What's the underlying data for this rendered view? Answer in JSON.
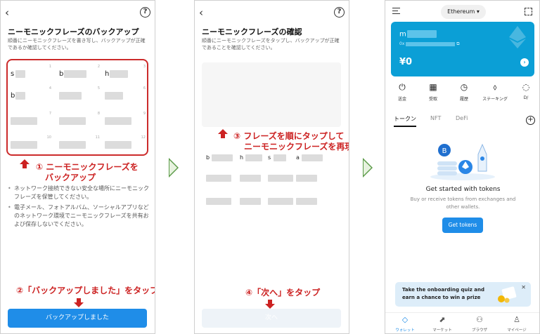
{
  "panel1": {
    "title": "ニーモニックフレーズのバックアップ",
    "subtitle": "順番にニーモニックフレーズを書き写し、バックアップが正確であるか確認してください。",
    "words": [
      {
        "n": "1",
        "prefix": "s"
      },
      {
        "n": "2",
        "prefix": "b"
      },
      {
        "n": "3",
        "prefix": "h"
      },
      {
        "n": "4",
        "prefix": "b"
      },
      {
        "n": "5",
        "prefix": ""
      },
      {
        "n": "6",
        "prefix": ""
      },
      {
        "n": "7",
        "prefix": ""
      },
      {
        "n": "8",
        "prefix": ""
      },
      {
        "n": "9",
        "prefix": ""
      },
      {
        "n": "10",
        "prefix": ""
      },
      {
        "n": "11",
        "prefix": ""
      },
      {
        "n": "12",
        "prefix": ""
      }
    ],
    "annotation_1a": "① ニーモニックフレーズを",
    "annotation_1b": "バックアップ",
    "bullet_1": "ネットワーク接続できない安全な場所にニーモニックフレーズを保管してください。",
    "bullet_2": "電子メール、フォトアルバム、ソーシャルアプリなどのネットワーク環境でニーモニックフレーズを共有および保存しないでください。",
    "annotation_2": "②「バックアップしました」をタップ",
    "button_label": "バックアップしました"
  },
  "panel2": {
    "title": "ニーモニックフレーズの確認",
    "subtitle": "順番にニーモニックフレーズをタップし、バックアップが正確であることを確認してください。",
    "annotation_3a": "③ フレーズを順にタップして",
    "annotation_3b": "ニーモニックフレーズを再現",
    "chips": [
      {
        "prefix": "b"
      },
      {
        "prefix": "h"
      },
      {
        "prefix": "s"
      },
      {
        "prefix": "a"
      },
      {
        "prefix": ""
      },
      {
        "prefix": ""
      },
      {
        "prefix": ""
      },
      {
        "prefix": ""
      },
      {
        "prefix": ""
      },
      {
        "prefix": ""
      },
      {
        "prefix": ""
      },
      {
        "prefix": ""
      }
    ],
    "annotation_4": "④「次へ」をタップ",
    "button_label": "次へ"
  },
  "panel3": {
    "network": "Ethereum",
    "wallet_name": "m",
    "address_prefix": "0x",
    "balance": "¥0",
    "actions": [
      {
        "label": "送金",
        "icon": "⏻"
      },
      {
        "label": "受取",
        "icon": "▦"
      },
      {
        "label": "履歴",
        "icon": "◷"
      },
      {
        "label": "ステーキング",
        "icon": "⬨"
      },
      {
        "label": "D/",
        "icon": "◌"
      }
    ],
    "tabs": [
      "トークン",
      "NFT",
      "DeFi"
    ],
    "empty_title": "Get started with tokens",
    "empty_sub": "Buy or receive tokens from exchanges and other wallets.",
    "get_tokens": "Get tokens",
    "banner_text": "Take the onboarding quiz and earn a chance to win a prize",
    "nav": [
      "ウォレット",
      "マーケット",
      "ブラウザ",
      "マイページ"
    ]
  },
  "colors": {
    "accent": "#1f8de8",
    "card": "#0b9fd6",
    "annotation": "#cc2222",
    "arrow": "#5a9a47"
  }
}
